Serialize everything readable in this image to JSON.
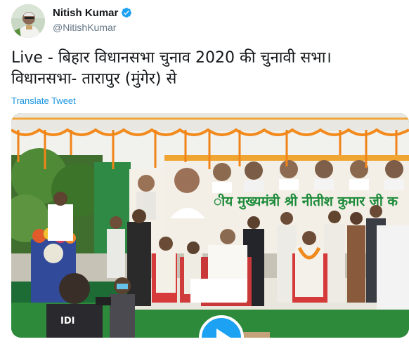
{
  "author": {
    "name": "Nitish Kumar",
    "handle": "@NitishKumar",
    "verified": true,
    "verified_color": "#1da1f2"
  },
  "tweet": {
    "line1": "Live - बिहार विधानसभा चुनाव 2020 की चुनावी सभा।",
    "line2": "विधानसभा- तारापुर (मुंगेर) से",
    "translate_label": "Translate Tweet"
  },
  "media": {
    "type": "video",
    "banner_text": "ीय मुख्यमंत्री श्री नीतीश कुमार जी क",
    "jacket_text": "IDI",
    "play_icon": "play-icon",
    "accent": "#1da1f2"
  }
}
